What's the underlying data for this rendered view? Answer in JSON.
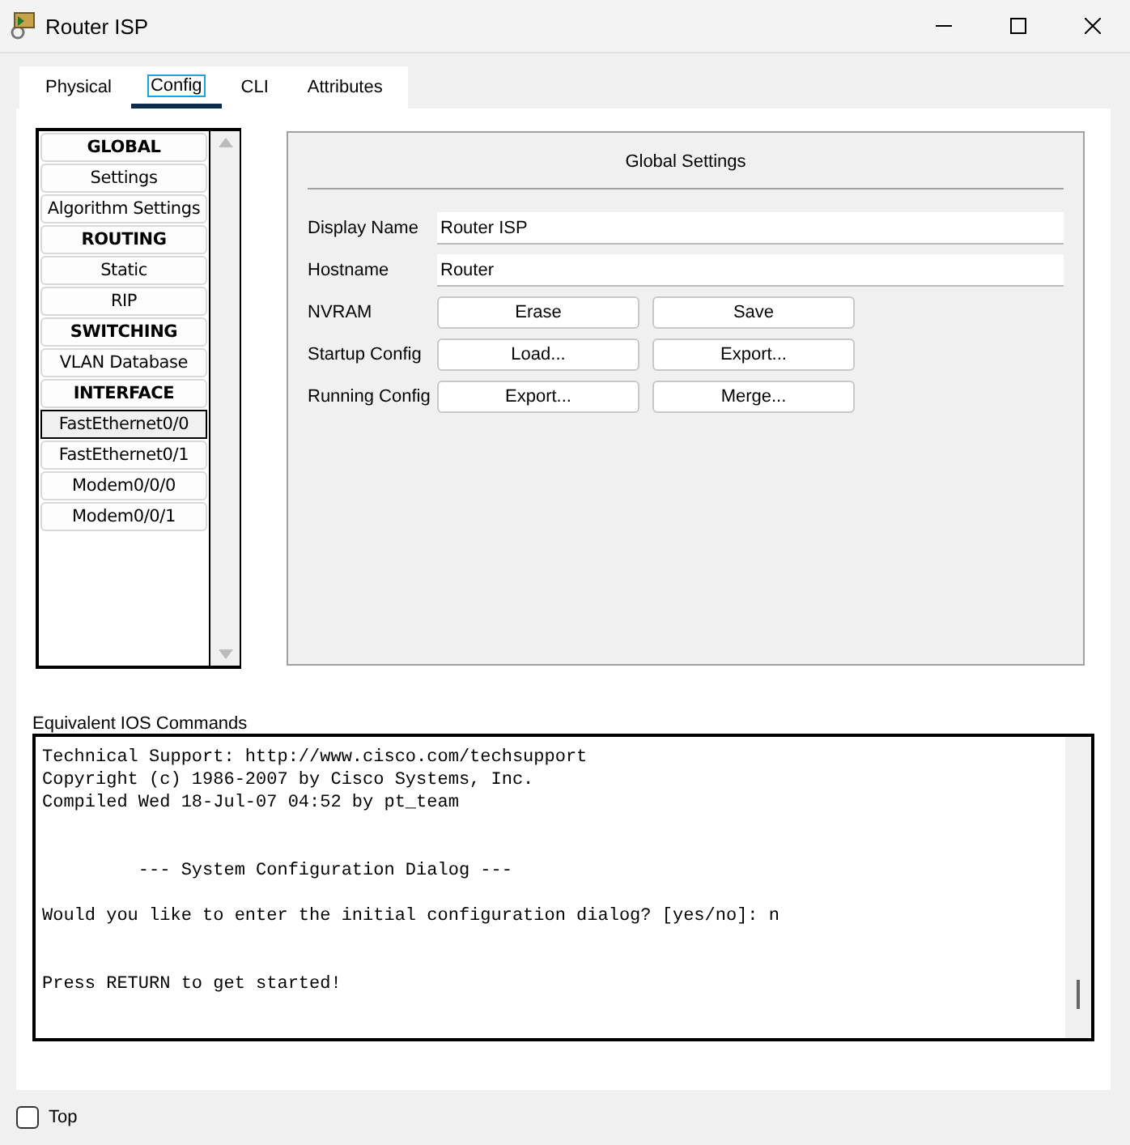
{
  "window": {
    "title": "Router ISP"
  },
  "tabs": [
    {
      "label": "Physical",
      "selected": false
    },
    {
      "label": "Config",
      "selected": true
    },
    {
      "label": "CLI",
      "selected": false
    },
    {
      "label": "Attributes",
      "selected": false
    }
  ],
  "sidebar": {
    "items": [
      {
        "label": "GLOBAL",
        "kind": "header",
        "selected": false
      },
      {
        "label": "Settings",
        "kind": "item",
        "selected": false
      },
      {
        "label": "Algorithm Settings",
        "kind": "item",
        "selected": false
      },
      {
        "label": "ROUTING",
        "kind": "header",
        "selected": false
      },
      {
        "label": "Static",
        "kind": "item",
        "selected": false
      },
      {
        "label": "RIP",
        "kind": "item",
        "selected": false
      },
      {
        "label": "SWITCHING",
        "kind": "header",
        "selected": false
      },
      {
        "label": "VLAN Database",
        "kind": "item",
        "selected": false
      },
      {
        "label": "INTERFACE",
        "kind": "header",
        "selected": false
      },
      {
        "label": "FastEthernet0/0",
        "kind": "item",
        "selected": true
      },
      {
        "label": "FastEthernet0/1",
        "kind": "item",
        "selected": false
      },
      {
        "label": "Modem0/0/0",
        "kind": "item",
        "selected": false
      },
      {
        "label": "Modem0/0/1",
        "kind": "item",
        "selected": false
      }
    ]
  },
  "settings": {
    "title": "Global Settings",
    "fields": [
      {
        "label": "Display Name",
        "value": "Router ISP"
      },
      {
        "label": "Hostname",
        "value": "Router"
      }
    ],
    "button_rows": [
      {
        "label": "NVRAM",
        "buttons": [
          "Erase",
          "Save"
        ]
      },
      {
        "label": "Startup Config",
        "buttons": [
          "Load...",
          "Export..."
        ]
      },
      {
        "label": "Running Config",
        "buttons": [
          "Export...",
          "Merge..."
        ]
      }
    ]
  },
  "ios_commands": {
    "label": "Equivalent IOS Commands",
    "output": "Technical Support: http://www.cisco.com/techsupport\nCopyright (c) 1986-2007 by Cisco Systems, Inc.\nCompiled Wed 18-Jul-07 04:52 by pt_team\n\n\n         --- System Configuration Dialog ---\n\nWould you like to enter the initial configuration dialog? [yes/no]: n\n\n\nPress RETURN to get started!"
  },
  "top_checkbox": {
    "label": "Top",
    "checked": false
  }
}
